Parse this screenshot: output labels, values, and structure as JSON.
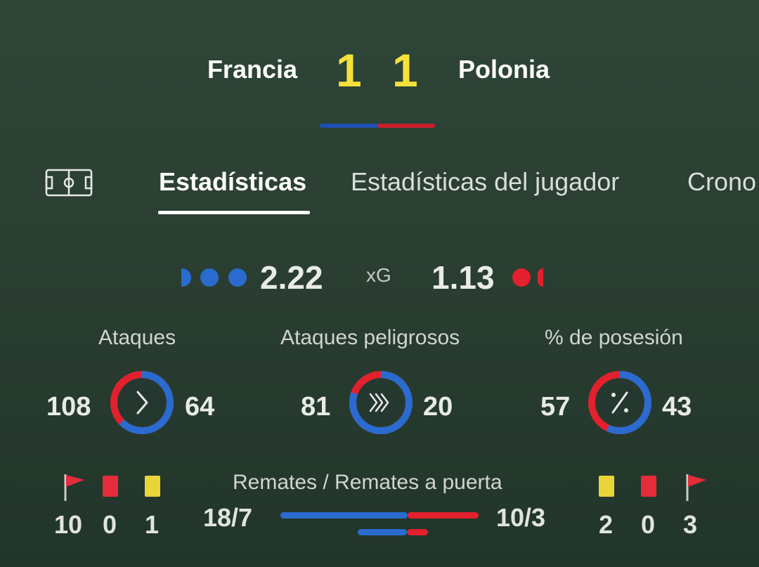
{
  "match": {
    "home_team": "Francia",
    "away_team": "Polonia",
    "home_score": "1",
    "away_score": "1",
    "home_color": "#2a6bd0",
    "away_color": "#e3202e",
    "score_color": "#f5e13a"
  },
  "tabs": [
    {
      "label": "Estadísticas",
      "active": true
    },
    {
      "label": "Estadísticas del jugador",
      "active": false
    },
    {
      "label": "Crono",
      "active": false
    }
  ],
  "field_icon": "soccer-field-icon",
  "xg": {
    "label": "xG",
    "home": "2.22",
    "away": "1.13"
  },
  "stats": [
    {
      "label": "Ataques",
      "home": "108",
      "away": "64",
      "icon": "chevron-right-icon",
      "home_fraction": 0.628
    },
    {
      "label": "Ataques peligrosos",
      "home": "81",
      "away": "20",
      "icon": "triple-chevron-icon",
      "home_fraction": 0.802
    },
    {
      "label": "% de posesión",
      "home": "57",
      "away": "43",
      "icon": "percent-icon",
      "home_fraction": 0.57
    }
  ],
  "bottom": {
    "home": {
      "corners": "10",
      "red_cards": "0",
      "yellow_cards": "1"
    },
    "away": {
      "yellow_cards": "2",
      "red_cards": "0",
      "corners": "3"
    },
    "shots_label": "Remates / Remates a puerta",
    "home_shots": "18/7",
    "away_shots": "10/3",
    "shots_home_fraction": 0.643,
    "on_target_home_fraction": 0.7
  }
}
